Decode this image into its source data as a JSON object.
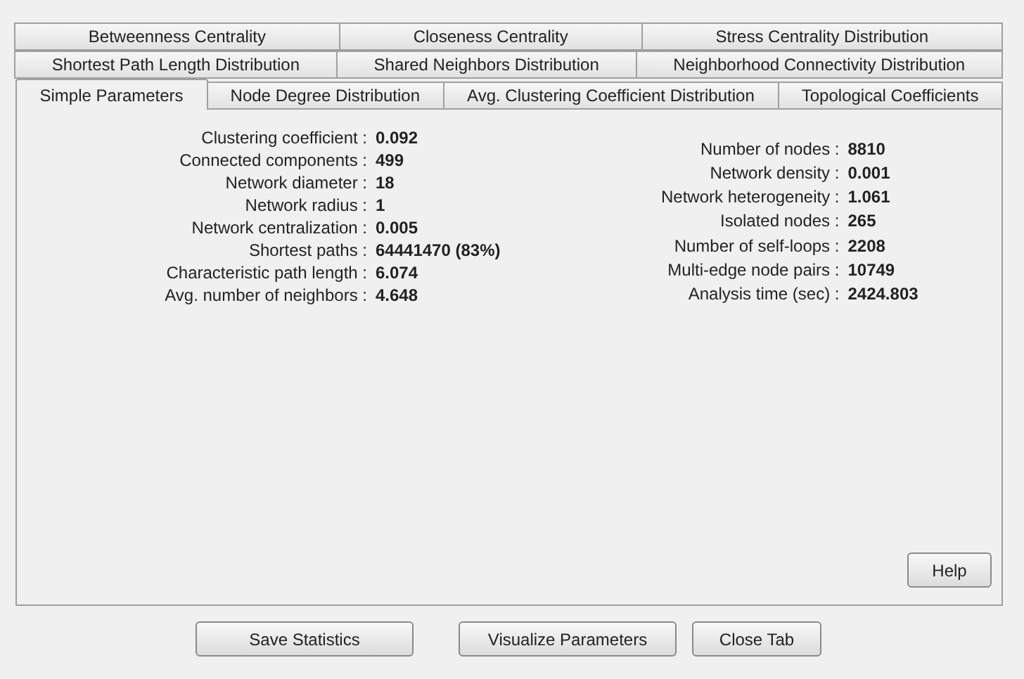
{
  "tab_rows": [
    [
      {
        "label": "Betweenness Centrality",
        "selected": false
      },
      {
        "label": "Closeness Centrality",
        "selected": false
      },
      {
        "label": "Stress Centrality Distribution",
        "selected": false
      }
    ],
    [
      {
        "label": "Shortest Path Length Distribution",
        "selected": false
      },
      {
        "label": "Shared Neighbors Distribution",
        "selected": false
      },
      {
        "label": "Neighborhood Connectivity Distribution",
        "selected": false
      }
    ],
    [
      {
        "label": "Simple Parameters",
        "selected": true
      },
      {
        "label": "Node Degree Distribution",
        "selected": false
      },
      {
        "label": "Avg. Clustering Coefficient Distribution",
        "selected": false
      },
      {
        "label": "Topological Coefficients",
        "selected": false
      }
    ]
  ],
  "statistics_left": [
    {
      "label": "Clustering coefficient :",
      "value": "0.092"
    },
    {
      "label": "Connected components :",
      "value": "499"
    },
    {
      "label": "Network diameter :",
      "value": "18"
    },
    {
      "label": "Network radius :",
      "value": "1"
    },
    {
      "label": "Network centralization :",
      "value": "0.005"
    },
    {
      "label": "Shortest paths :",
      "value": "64441470 (83%)"
    },
    {
      "label": "Characteristic path length :",
      "value": "6.074"
    },
    {
      "label": "Avg. number of neighbors :",
      "value": "4.648"
    }
  ],
  "statistics_right": [
    {
      "label": "Number of nodes :",
      "value": "8810"
    },
    {
      "label": "Network density :",
      "value": "0.001"
    },
    {
      "label": "Network heterogeneity :",
      "value": "1.061"
    },
    {
      "label": "Isolated nodes :",
      "value": "265"
    },
    {
      "label": "Number of self-loops :",
      "value": "2208"
    },
    {
      "label": "Multi-edge node pairs :",
      "value": "10749"
    },
    {
      "label": "Analysis time (sec) :",
      "value": "2424.803"
    }
  ],
  "help_button": "Help",
  "buttons": [
    "Save Statistics",
    "Visualize Parameters",
    "Close Tab"
  ]
}
